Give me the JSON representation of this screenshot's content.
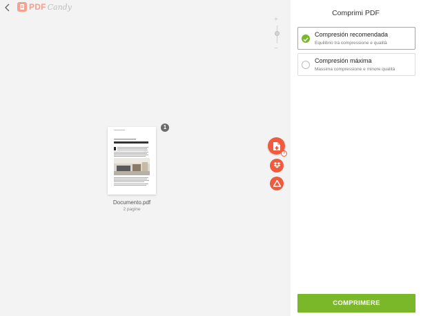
{
  "header": {
    "logo_text": "PDF",
    "logo_sub": "Candy"
  },
  "zoom": {
    "plus": "+",
    "minus": "−"
  },
  "document": {
    "name": "Documento.pdf",
    "pages": "2 pagine",
    "page_badge": "1"
  },
  "actions": {
    "help": "?"
  },
  "panel": {
    "title": "Comprimi PDF",
    "options": [
      {
        "title": "Compresión recomendada",
        "subtitle": "Equilibrio tra compressione e qualità",
        "selected": true
      },
      {
        "title": "Compresión máxima",
        "subtitle": "Massima compressione e minore qualità",
        "selected": false
      }
    ],
    "submit_label": "COMPRIMERE"
  },
  "colors": {
    "accent_green": "#7ab829",
    "accent_orange": "#ef5b3c",
    "logo_pink": "#f2a092"
  }
}
